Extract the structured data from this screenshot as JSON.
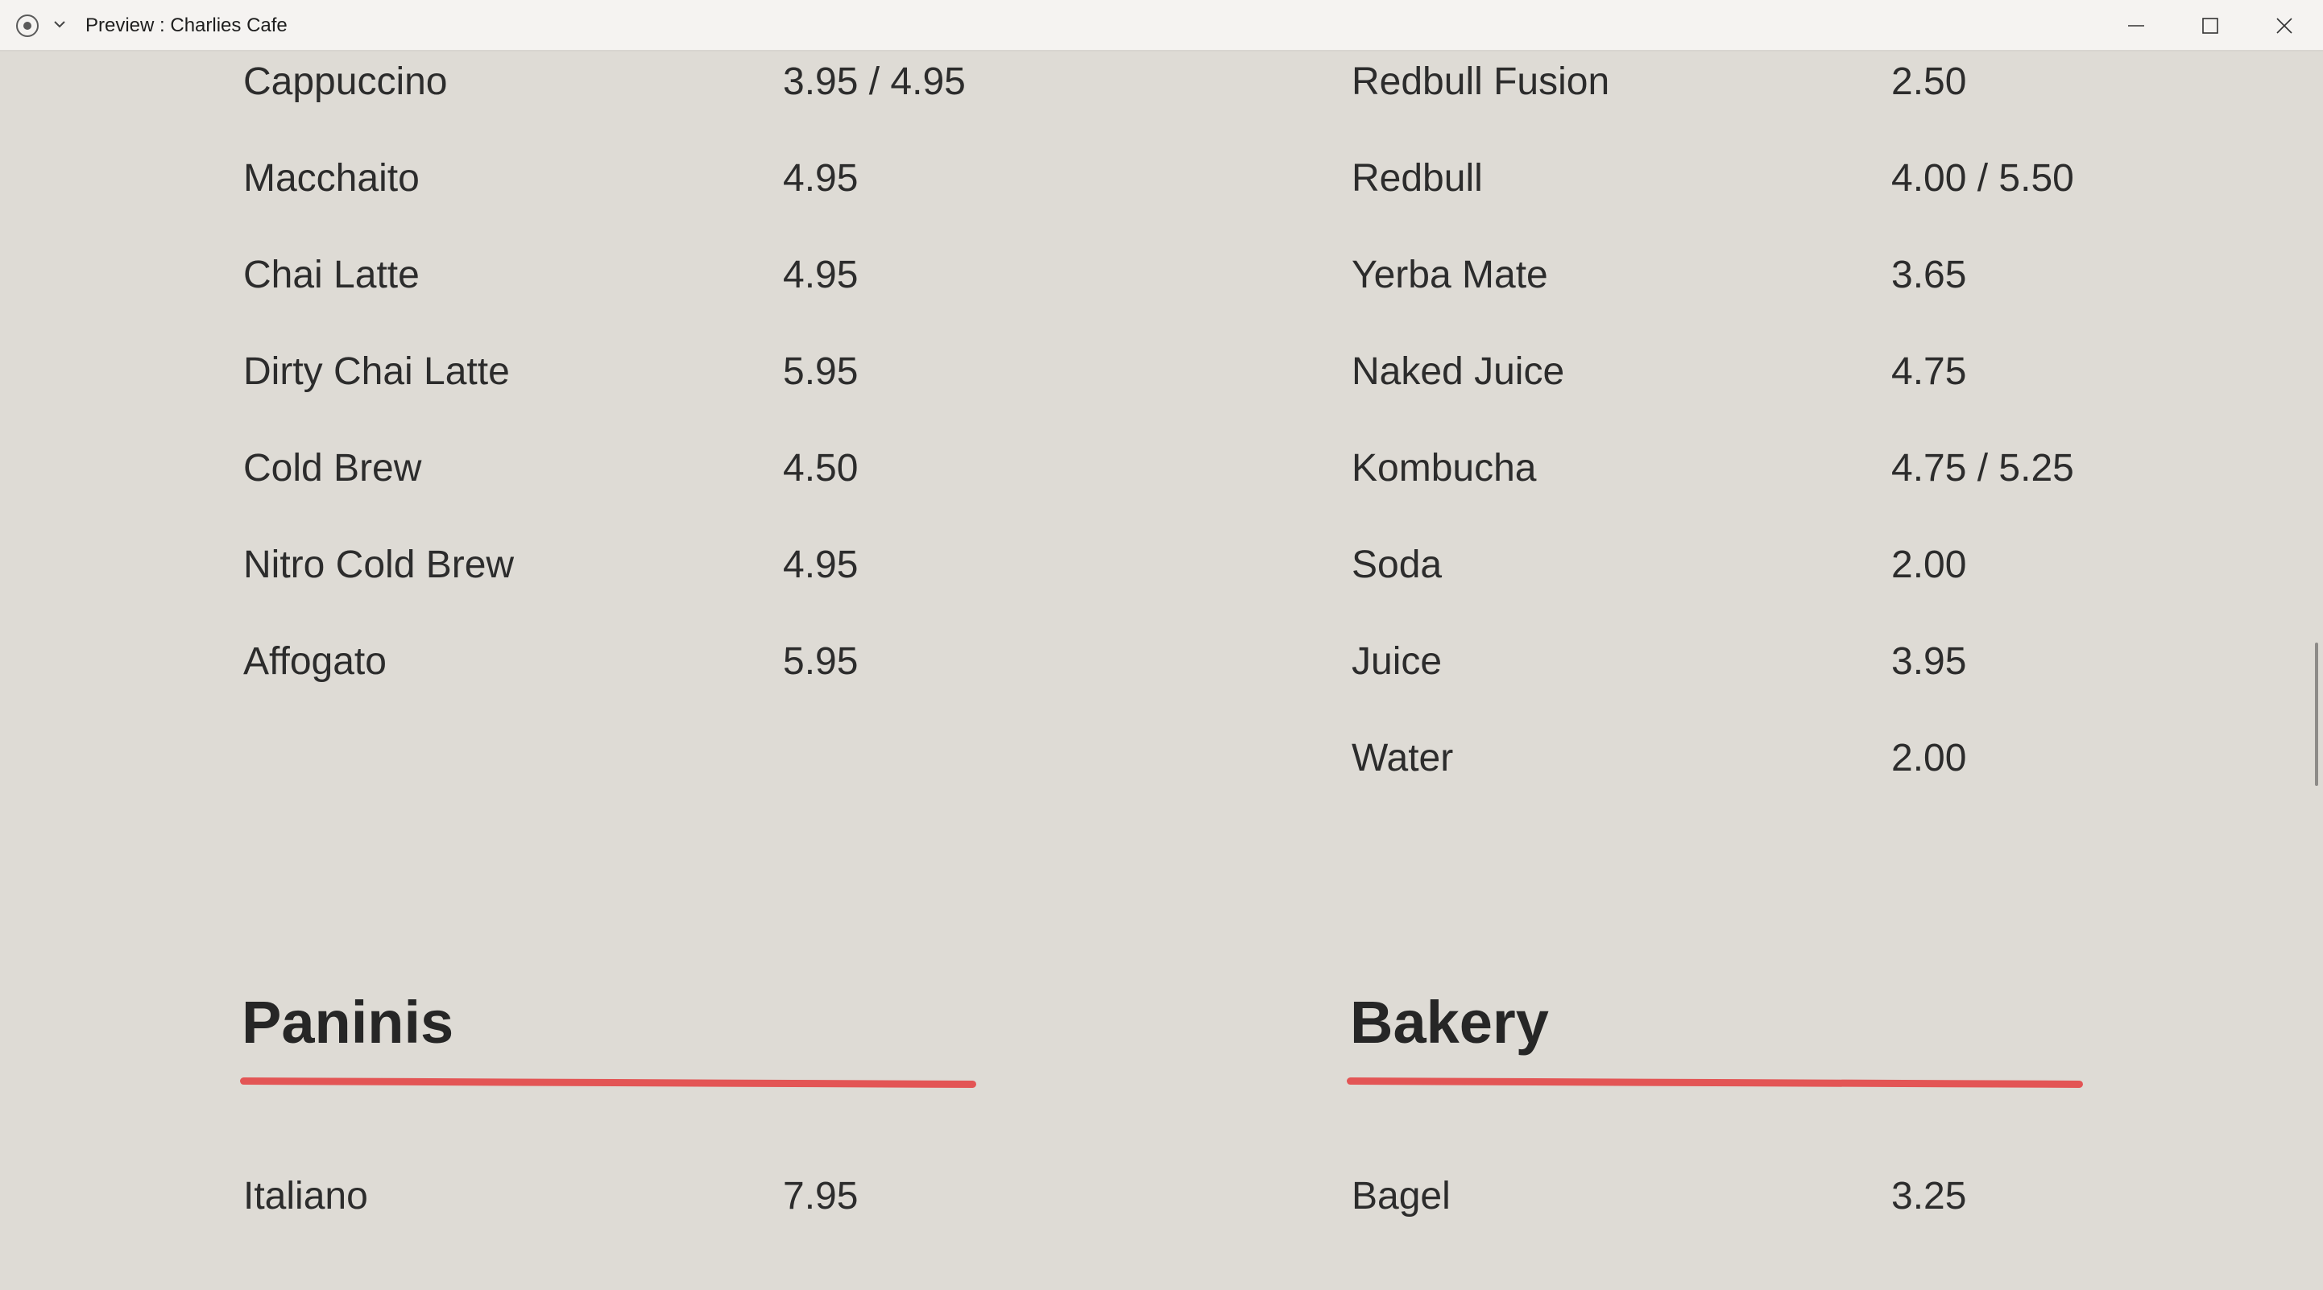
{
  "window": {
    "title": "Preview : Charlies Cafe"
  },
  "menu": {
    "left_items": [
      {
        "name": "Cappuccino",
        "price": "3.95 / 4.95"
      },
      {
        "name": "Macchaito",
        "price": "4.95"
      },
      {
        "name": "Chai Latte",
        "price": "4.95"
      },
      {
        "name": "Dirty Chai Latte",
        "price": "5.95"
      },
      {
        "name": "Cold Brew",
        "price": "4.50"
      },
      {
        "name": "Nitro Cold Brew",
        "price": "4.95"
      },
      {
        "name": "Affogato",
        "price": "5.95"
      }
    ],
    "right_items": [
      {
        "name": "Redbull Fusion",
        "price": "2.50"
      },
      {
        "name": "Redbull",
        "price": "4.00 / 5.50"
      },
      {
        "name": "Yerba Mate",
        "price": "3.65"
      },
      {
        "name": "Naked Juice",
        "price": "4.75"
      },
      {
        "name": "Kombucha",
        "price": "4.75 / 5.25"
      },
      {
        "name": "Soda",
        "price": "2.00"
      },
      {
        "name": "Juice",
        "price": "3.95"
      },
      {
        "name": "Water",
        "price": "2.00"
      }
    ],
    "paninis": {
      "heading": "Paninis",
      "items": [
        {
          "name": "Italiano",
          "price": "7.95"
        }
      ]
    },
    "bakery": {
      "heading": "Bakery",
      "items": [
        {
          "name": "Bagel",
          "price": "3.25"
        }
      ]
    }
  },
  "colors": {
    "background": "#dedbd5",
    "accent_underline": "#e35555",
    "text": "#2c2c2c"
  }
}
